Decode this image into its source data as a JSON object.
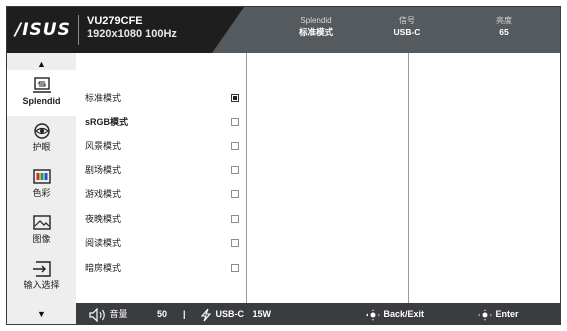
{
  "header": {
    "logo": "/ISUS",
    "model_name": "VU279CFE",
    "resolution": "1920x1080 100Hz",
    "stats": [
      {
        "key": "Splendid",
        "value": "标准模式"
      },
      {
        "key": "信号",
        "value": "USB-C"
      },
      {
        "key": "亮度",
        "value": "65"
      }
    ]
  },
  "nav": {
    "up_arrow": "▲",
    "down_arrow": "▼",
    "items": [
      {
        "label": "Splendid",
        "icon": "splendid-icon",
        "active": true
      },
      {
        "label": "护眼",
        "icon": "eye-care-icon",
        "active": false
      },
      {
        "label": "色彩",
        "icon": "color-icon",
        "active": false
      },
      {
        "label": "图像",
        "icon": "image-icon",
        "active": false
      },
      {
        "label": "输入选择",
        "icon": "input-select-icon",
        "active": false
      }
    ]
  },
  "modes": [
    {
      "label": "标准模式",
      "selected": true
    },
    {
      "label": "sRGB模式",
      "selected": false
    },
    {
      "label": "风景模式",
      "selected": false
    },
    {
      "label": "剧场模式",
      "selected": false
    },
    {
      "label": "游戏模式",
      "selected": false
    },
    {
      "label": "夜晚模式",
      "selected": false
    },
    {
      "label": "阅读模式",
      "selected": false
    },
    {
      "label": "暗房模式",
      "selected": false
    }
  ],
  "footer": {
    "volume_label": "音量",
    "volume_value": "50",
    "divider": "|",
    "power_label": "USB-C",
    "power_value": "15W",
    "back_label": "Back/Exit",
    "enter_label": "Enter"
  },
  "colors": {
    "header_dark": "#1e1e1e",
    "header_panel": "#555a5e",
    "nav_bg": "#eeeeee",
    "footer_bg": "#3a3c3f"
  }
}
